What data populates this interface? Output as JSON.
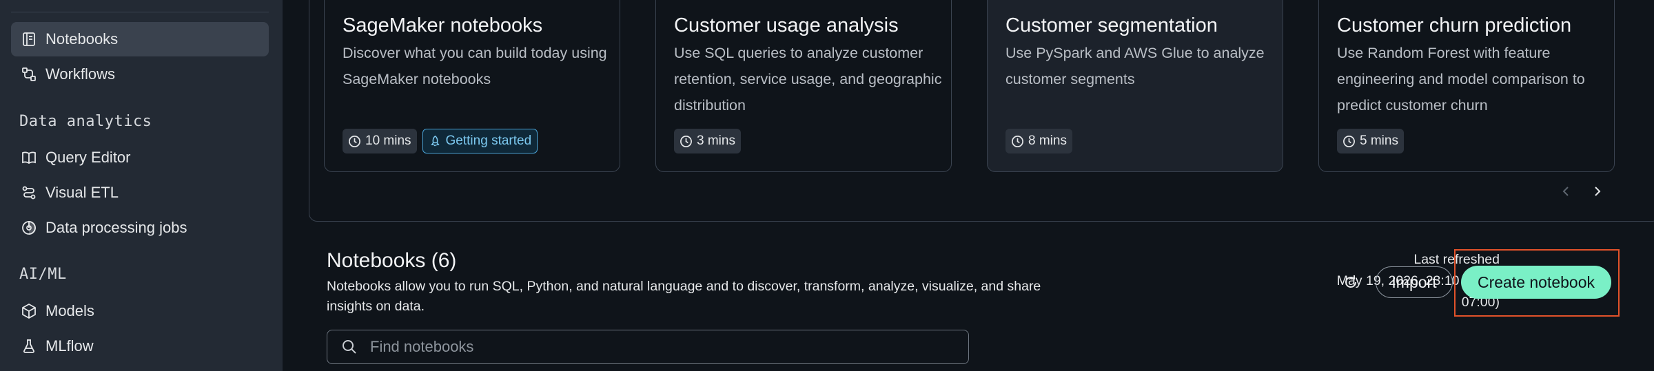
{
  "sidebar": {
    "items_top": [
      {
        "label": "Notebooks",
        "icon": "notebook-icon",
        "active": true
      },
      {
        "label": "Workflows",
        "icon": "workflow-icon",
        "active": false
      }
    ],
    "sections": [
      {
        "heading": "Data analytics",
        "items": [
          {
            "label": "Query Editor",
            "icon": "book-icon"
          },
          {
            "label": "Visual ETL",
            "icon": "etl-icon"
          },
          {
            "label": "Data processing jobs",
            "icon": "processing-icon"
          }
        ]
      },
      {
        "heading": "AI/ML",
        "items": [
          {
            "label": "Models",
            "icon": "cube-icon"
          },
          {
            "label": "MLflow",
            "icon": "flask-icon"
          }
        ]
      }
    ]
  },
  "cards": [
    {
      "title": "SageMaker notebooks",
      "description": "Discover what you can build today using SageMaker notebooks",
      "duration": "10 mins",
      "badge": "Getting started"
    },
    {
      "title": "Customer usage analysis",
      "description": "Use SQL queries to analyze customer retention, service usage, and geographic distribution",
      "duration": "3 mins"
    },
    {
      "title": "Customer segmentation",
      "description": "Use PySpark and AWS Glue to analyze customer segments",
      "duration": "8 mins"
    },
    {
      "title": "Customer churn prediction",
      "description": "Use Random Forest with feature engineering and model comparison to predict customer churn",
      "duration": "5 mins"
    }
  ],
  "notebooks": {
    "title": "Notebooks (6)",
    "description": "Notebooks allow you to run SQL, Python, and natural language and to discover, transform, analyze, visualize, and share insights on data.",
    "last_refreshed_label": "Last refreshed",
    "last_refreshed_value": "May 19, 2026, 23:10 (UTC-07:00)",
    "import_label": "Import",
    "create_label": "Create notebook",
    "search_placeholder": "Find notebooks"
  },
  "colors": {
    "background": "#0f141a",
    "sidebar": "#232a34",
    "primary_button": "#7af0c6",
    "highlight": "#e2522a",
    "badge": "#7cc8ef"
  }
}
